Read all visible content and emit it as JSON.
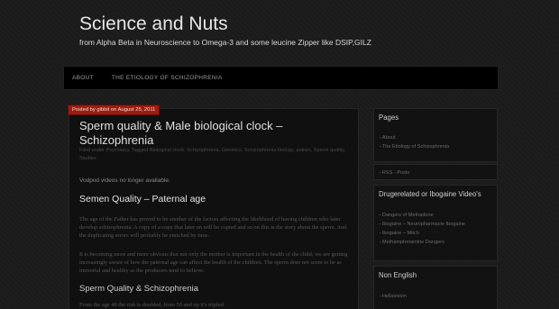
{
  "site": {
    "title": "Science and Nuts",
    "description": "from Alpha Beta in Neuroscience to Omega-3 and some leucine Zipper like DSIP,GILZ"
  },
  "nav": {
    "items": [
      "ABOUT",
      "THE ETIOLOGY OF SCHIZOPHRENIA"
    ]
  },
  "post": {
    "posted": "Posted by gibbit on August 25, 2011",
    "title": "Sperm quality & Male biological clock – Schizophrenia",
    "meta": "Filed under Psychiatry, Tagged Biological clock, Schizophrenia, Genetics, Schizophrenia biology, autism, Sperm quality, Studies",
    "notice": "Vodpod videos no longer available.",
    "heading1": "Semen Quality – Paternal age",
    "para1": "The age of the Father has proved to be another of the factors affecting the likelihood of having children who later develop schizophrenia. A copy of a copy that later on will be copied and so on this is the story about the sperm. And the duplicating errors will probably be enriched by time.",
    "para2": "It is becoming more and more obvious that not only the mother is important in the health of the child; we are getting increasingly aware of how the paternal age can affect the health of the children. The sperm does not seem to be as immortal and healthy as the producers tend to believe.",
    "heading2": "Sperm Quality & Schizophrenia",
    "para3": "From the age 40 the risk is doubled, from 50 and up it's tripled."
  },
  "sidebar": {
    "pages": {
      "title": "Pages",
      "items": [
        "About",
        "The Etiology of Schizophrenia"
      ]
    },
    "rss": {
      "items": [
        "RSS - Posts"
      ]
    },
    "drug": {
      "title": "Drugerelated or Ibogaine Video's",
      "items": [
        "Dangers of Methadone",
        "Ibogaine – Neuropharmacie Ibogaine",
        "Ibogaine – Mitch",
        "Methamphetamine Dangers"
      ]
    },
    "nonenglish": {
      "title": "Non English",
      "items": [
        "Hellavision"
      ]
    }
  }
}
